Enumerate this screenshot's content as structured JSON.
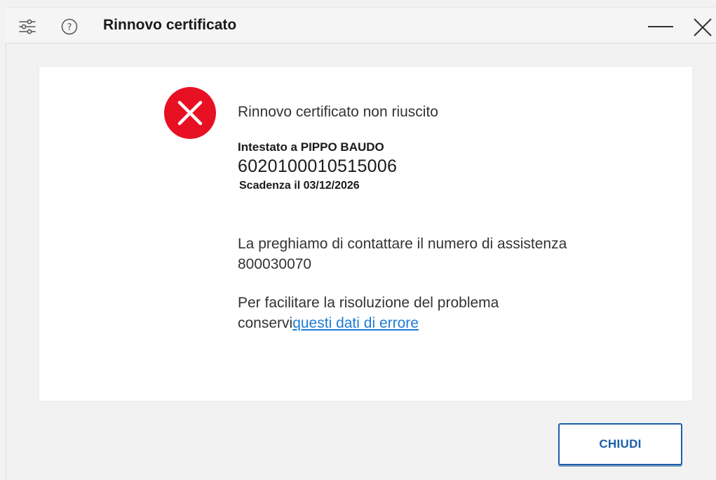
{
  "window": {
    "title": "Rinnovo certificato"
  },
  "titlebar_icons": {
    "settings": "settings-sliders-icon",
    "help": "help-circle-icon",
    "minimize": "minimize-icon",
    "close": "close-icon"
  },
  "result": {
    "status_icon": "error-x-circle-icon",
    "status_color": "#e81123",
    "status_text": "Rinnovo certificato non riuscito",
    "holder": "Intestato a PIPPO BAUDO",
    "serial": "6020100010515006",
    "expiry": "Scadenza il 03/12/2026"
  },
  "support": {
    "line1": "La preghiamo di contattare il numero di assistenza",
    "line2": "800030070",
    "line3": "Per facilitare la risoluzione del problema",
    "line4_prefix": "conservi",
    "line4_link": "questi dati di errore"
  },
  "actions": {
    "close_label": "CHIUDI"
  },
  "colors": {
    "accent": "#1b5fa8",
    "link": "#1e7bd4",
    "error": "#e81123"
  }
}
